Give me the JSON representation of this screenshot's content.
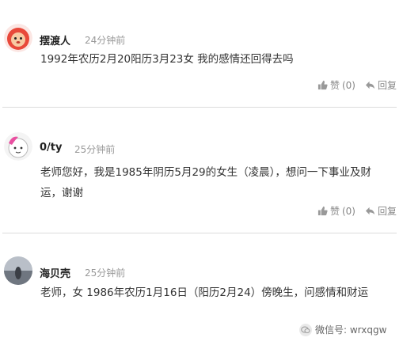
{
  "comments": [
    {
      "username": "摆渡人",
      "time": "24分钟前",
      "text": "1992年农历2月20阳历3月23女 我的感情还回得去吗",
      "like_label": "赞",
      "like_count": "(0)",
      "reply_label": "回复",
      "avatar": "cartoon-lion-avatar"
    },
    {
      "username": "0/ty",
      "time": "25分钟前",
      "text_line1": "老师您好，我是1985年阴历5月29的女生（凌晨），想问一下事业及财",
      "text_line2": "运，谢谢",
      "like_label": "赞",
      "like_count": "(0)",
      "reply_label": "回复",
      "avatar": "cartoon-face-avatar"
    },
    {
      "username": "海贝壳",
      "time": "25分钟前",
      "text": "老师，女 1986年农历1月16日（阳历2月24）傍晚生，问感情和财运",
      "avatar": "photo-avatar"
    }
  ],
  "watermark": {
    "text": "微信号: wrxqgw",
    "icon": "wechat-icon"
  },
  "colors": {
    "divider": "#dcdcdc",
    "meta": "#999999",
    "text": "#333333"
  }
}
